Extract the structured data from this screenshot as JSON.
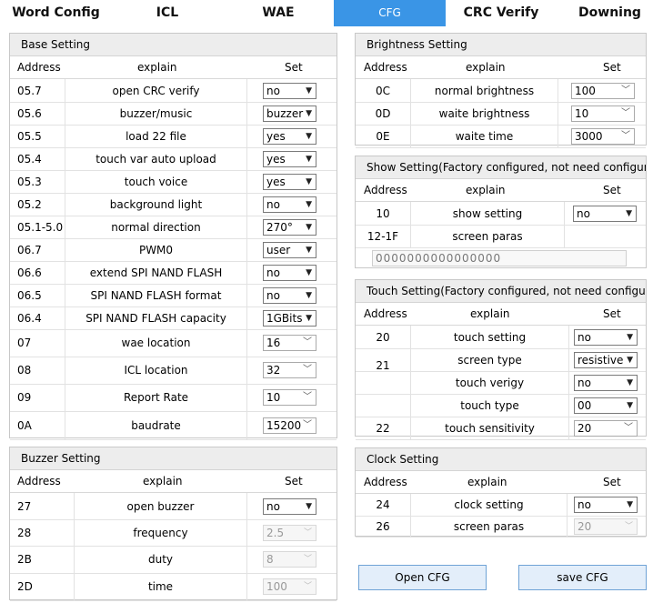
{
  "tabs": [
    "Word Config",
    "ICL",
    "WAE",
    "CFG",
    "CRC Verify",
    "Downing"
  ],
  "headers": {
    "address": "Address",
    "explain": "explain",
    "set": "Set"
  },
  "base": {
    "title": "Base Setting",
    "rows": [
      {
        "addr": "05.7",
        "exp": "open CRC verify",
        "val": "no"
      },
      {
        "addr": "05.6",
        "exp": "buzzer/music",
        "val": "buzzer"
      },
      {
        "addr": "05.5",
        "exp": "load 22 file",
        "val": "yes"
      },
      {
        "addr": "05.4",
        "exp": "touch var auto upload",
        "val": "yes"
      },
      {
        "addr": "05.3",
        "exp": "touch voice",
        "val": "yes"
      },
      {
        "addr": "05.2",
        "exp": "background light",
        "val": "no"
      },
      {
        "addr": "05.1-5.0",
        "exp": "normal direction",
        "val": "270°"
      },
      {
        "addr": "06.7",
        "exp": "PWM0",
        "val": "user"
      },
      {
        "addr": "06.6",
        "exp": "extend SPI NAND FLASH",
        "val": "no"
      },
      {
        "addr": "06.5",
        "exp": "SPI NAND FLASH format",
        "val": "no"
      },
      {
        "addr": "06.4",
        "exp": "SPI NAND FLASH capacity",
        "val": "1GBits"
      },
      {
        "addr": "07",
        "exp": "wae location",
        "val": "16"
      },
      {
        "addr": "08",
        "exp": "ICL location",
        "val": "32"
      },
      {
        "addr": "09",
        "exp": "Report Rate",
        "val": "10"
      },
      {
        "addr": "0A",
        "exp": "baudrate",
        "val": "15200"
      }
    ]
  },
  "buzzer": {
    "title": "Buzzer Setting",
    "rows": [
      {
        "addr": "27",
        "exp": "open buzzer",
        "val": "no"
      },
      {
        "addr": "28",
        "exp": "frequency",
        "val": "2.5"
      },
      {
        "addr": "2B",
        "exp": "duty",
        "val": "8"
      },
      {
        "addr": "2D",
        "exp": "time",
        "val": "100"
      }
    ]
  },
  "brightness": {
    "title": "Brightness Setting",
    "rows": [
      {
        "addr": "0C",
        "exp": "normal brightness",
        "val": "100"
      },
      {
        "addr": "0D",
        "exp": "waite brightness",
        "val": "10"
      },
      {
        "addr": "0E",
        "exp": "waite time",
        "val": "3000"
      }
    ]
  },
  "show": {
    "title": "Show Setting(Factory configured, not need configure)",
    "rows": [
      {
        "addr": "10",
        "exp": "show setting",
        "val": "no"
      },
      {
        "addr": "12-1F",
        "exp": "screen paras",
        "val": ""
      }
    ],
    "paras": "0000000000000000"
  },
  "touch": {
    "title": "Touch Setting(Factory configured, not need configure)",
    "rows": [
      {
        "addr": "20",
        "exp": "touch setting",
        "val": "no"
      },
      {
        "addr": "21",
        "exp": "screen type",
        "val": "resistive"
      },
      {
        "addr": "",
        "exp": "touch verigy",
        "val": "no"
      },
      {
        "addr": "",
        "exp": "touch type",
        "val": "00"
      },
      {
        "addr": "22",
        "exp": "touch sensitivity",
        "val": "20"
      }
    ]
  },
  "clock": {
    "title": "Clock Setting",
    "rows": [
      {
        "addr": "24",
        "exp": "clock setting",
        "val": "no"
      },
      {
        "addr": "26",
        "exp": "screen paras",
        "val": "20"
      }
    ]
  },
  "buttons": {
    "open": "Open CFG",
    "save": "save CFG"
  },
  "icons": {
    "dropdown": "chevron-down-icon"
  },
  "colors": {
    "active_tab": "#3a95e6",
    "button_fill": "#e3eefa"
  }
}
